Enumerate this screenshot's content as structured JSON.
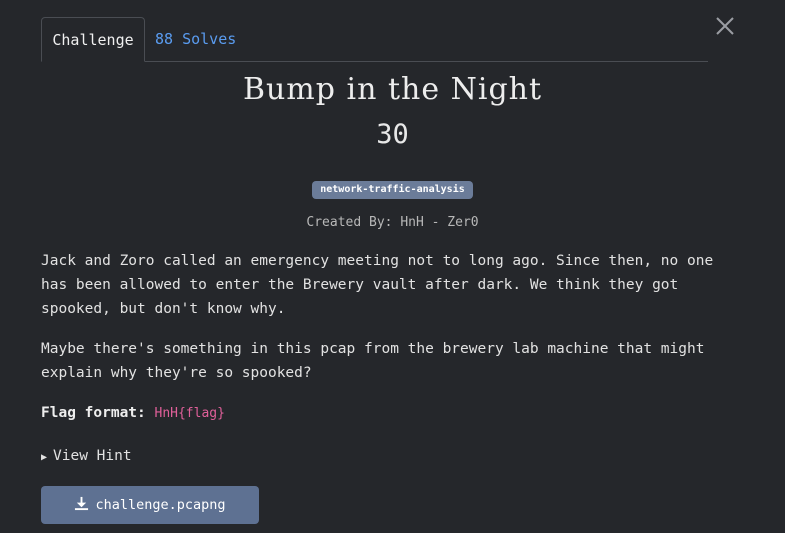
{
  "tabs": {
    "challenge_label": "Challenge",
    "solves_label": "88 Solves"
  },
  "challenge": {
    "title": "Bump in the Night",
    "points": "30",
    "tag": "network-traffic-analysis",
    "author": "Created By: HnH - Zer0",
    "description_p1": "Jack and Zoro called an emergency meeting not to long ago. Since then, no one has been allowed to enter the Brewery vault after dark. We think they got spooked, but don't know why.",
    "description_p2": "Maybe there's something in this pcap from the brewery lab machine that might explain why they're so spooked?",
    "flag_label": "Flag format:",
    "flag_format": "HnH{flag}",
    "hint_label": "View Hint",
    "download_label": "challenge.pcapng"
  },
  "icons": {
    "close": "close-icon",
    "hint": "triangle-right-icon",
    "download": "download-icon"
  },
  "colors": {
    "background": "#25272b",
    "accent_link": "#5a9cf0",
    "badge": "#6b7c99",
    "button": "#5e7192",
    "flag_code": "#e0609a"
  }
}
